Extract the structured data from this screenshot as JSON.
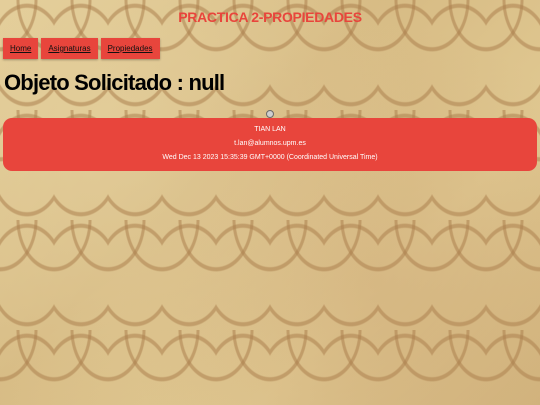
{
  "site": {
    "title": "PRACTICA 2-PROPIEDADES"
  },
  "nav": {
    "items": [
      {
        "label": "Home"
      },
      {
        "label": "Asignaturas"
      },
      {
        "label": "Propiedades"
      }
    ]
  },
  "main": {
    "heading": "Objeto Solicitado : null"
  },
  "card": {
    "name": "TIAN LAN",
    "email": "t.lan@alumnos.upm.es",
    "date": "Wed Dec 13 2023 15:35:39 GMT+0000 (Coordinated Universal Time)"
  },
  "colors": {
    "accent": "#e8453c",
    "background": "#dcc48e"
  },
  "icons": {
    "broken_image": "broken-image-icon"
  }
}
